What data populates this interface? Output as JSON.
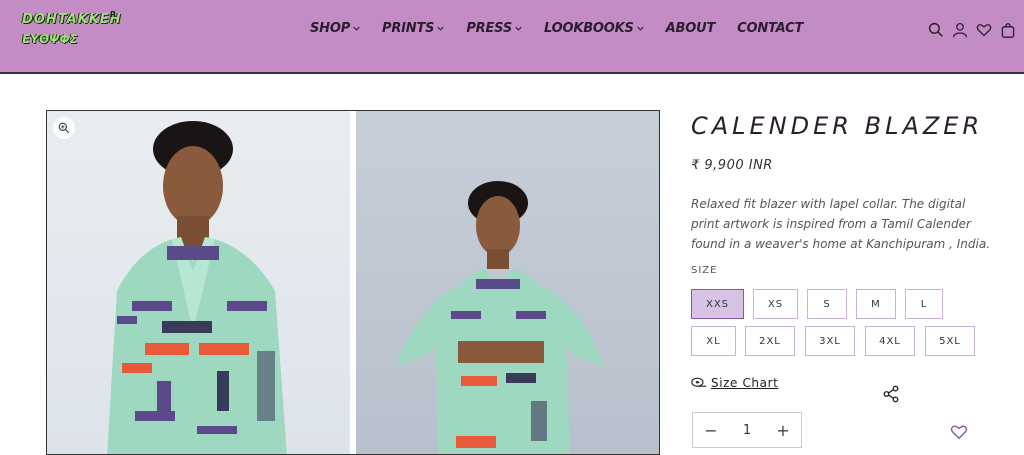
{
  "brand": {
    "logo_top": "DOHTAKKEH",
    "logo_bottom": "ΕΥΘΨΦΣ",
    "logo_mark": "R"
  },
  "nav": [
    {
      "label": "SHOP",
      "dropdown": true
    },
    {
      "label": "PRINTS",
      "dropdown": true
    },
    {
      "label": "PRESS",
      "dropdown": true
    },
    {
      "label": "LOOKBOOKS",
      "dropdown": true
    },
    {
      "label": "ABOUT",
      "dropdown": false
    },
    {
      "label": "CONTACT",
      "dropdown": false
    }
  ],
  "header_icons": [
    "search-icon",
    "account-icon",
    "wishlist-icon",
    "cart-icon"
  ],
  "product": {
    "title": "CALENDER BLAZER",
    "price": "₹ 9,900 INR",
    "description": "Relaxed fit blazer with lapel collar. The digital print artwork is inspired from a Tamil Calender found in a weaver's home at Kanchipuram , India.",
    "size_label": "SIZE",
    "sizes": [
      "XXS",
      "XS",
      "S",
      "M",
      "L",
      "XL",
      "2XL",
      "3XL",
      "4XL",
      "5XL"
    ],
    "selected_size": "XXS",
    "size_chart_label": "Size Chart",
    "quantity": "1",
    "minus": "−",
    "plus": "+"
  },
  "colors": {
    "header_bg": "#c48cc4",
    "accent": "#d7c2e6",
    "accent_border": "#8a5aa7",
    "text": "#2a1d2e",
    "logo_green": "#9ee07a"
  }
}
